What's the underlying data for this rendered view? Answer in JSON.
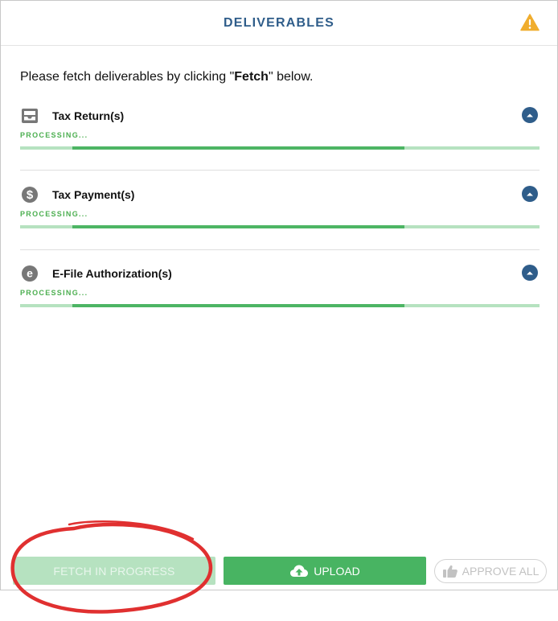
{
  "header": {
    "title": "DELIVERABLES",
    "warning_icon": "warning-triangle-icon"
  },
  "intro": {
    "prefix": "Please fetch deliverables by clicking \"",
    "bold": "Fetch",
    "suffix": "\" below."
  },
  "sections": [
    {
      "title": "Tax Return(s)",
      "icon": "inbox-tray-icon",
      "status": "PROCESSING...",
      "progress_segment": [
        0.1,
        0.74
      ]
    },
    {
      "title": "Tax Payment(s)",
      "icon": "dollar-circle-icon",
      "status": "PROCESSING...",
      "progress_segment": [
        0.1,
        0.74
      ]
    },
    {
      "title": "E-File Authorization(s)",
      "icon": "e-circle-icon",
      "status": "PROCESSING...",
      "progress_segment": [
        0.1,
        0.74
      ]
    }
  ],
  "buttons": {
    "fetch": "FETCH IN PROGRESS",
    "upload": "UPLOAD",
    "approve": "APPROVE ALL"
  },
  "colors": {
    "accent_blue": "#2f5d8a",
    "progress_green": "#4db564",
    "progress_track": "#b6e2c0",
    "warning": "#f0ad2e",
    "annotation_red": "#e03030"
  }
}
